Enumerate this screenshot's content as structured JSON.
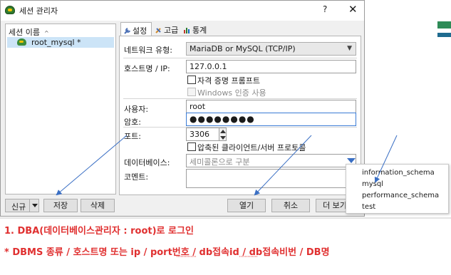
{
  "window": {
    "title": "세션 관리자",
    "help": "?",
    "close": "✕"
  },
  "session_list": {
    "header": "세션 이름",
    "sort_indicator": "^",
    "items": [
      {
        "label": "root_mysql *"
      }
    ]
  },
  "bottom_buttons": {
    "new": "신규",
    "save": "저장",
    "delete": "삭제",
    "open": "열기",
    "cancel": "취소",
    "more": "더 보기"
  },
  "tabs": [
    {
      "label": "설정",
      "icon": "wrench-icon"
    },
    {
      "label": "고급",
      "icon": "tools-icon"
    },
    {
      "label": "통계",
      "icon": "chart-icon"
    }
  ],
  "form": {
    "network_type_label": "네트워크 유형:",
    "network_type_value": "MariaDB or MySQL (TCP/IP)",
    "host_label": "호스트명 / IP:",
    "host_value": "127.0.0.1",
    "prompt_credentials": "자격 증명 프롬프트",
    "windows_auth": "Windows 인증 사용",
    "user_label": "사용자:",
    "user_value": "root",
    "password_label": "암호:",
    "password_value": "●●●●●●●●",
    "port_label": "포트:",
    "port_value": "3306",
    "compressed_protocol": "압축된 클라이언트/서버 프로토콜",
    "database_label": "데이터베이스:",
    "database_placeholder": "세미콜론으로 구분",
    "comment_label": "코멘트:"
  },
  "database_dropdown": [
    "information_schema",
    "mysql",
    "performance_schema",
    "test"
  ],
  "annotations": {
    "line1": "1.    DBA(데이터베이스관리자 : root)로 로그인",
    "line2": "* DBMS 종류 / 호스트명 또는 ip / port번호 / db접속id / db접속비번 / DB명"
  },
  "colors": {
    "annotation_text": "#e03030",
    "arrow": "#3a6fc4"
  }
}
